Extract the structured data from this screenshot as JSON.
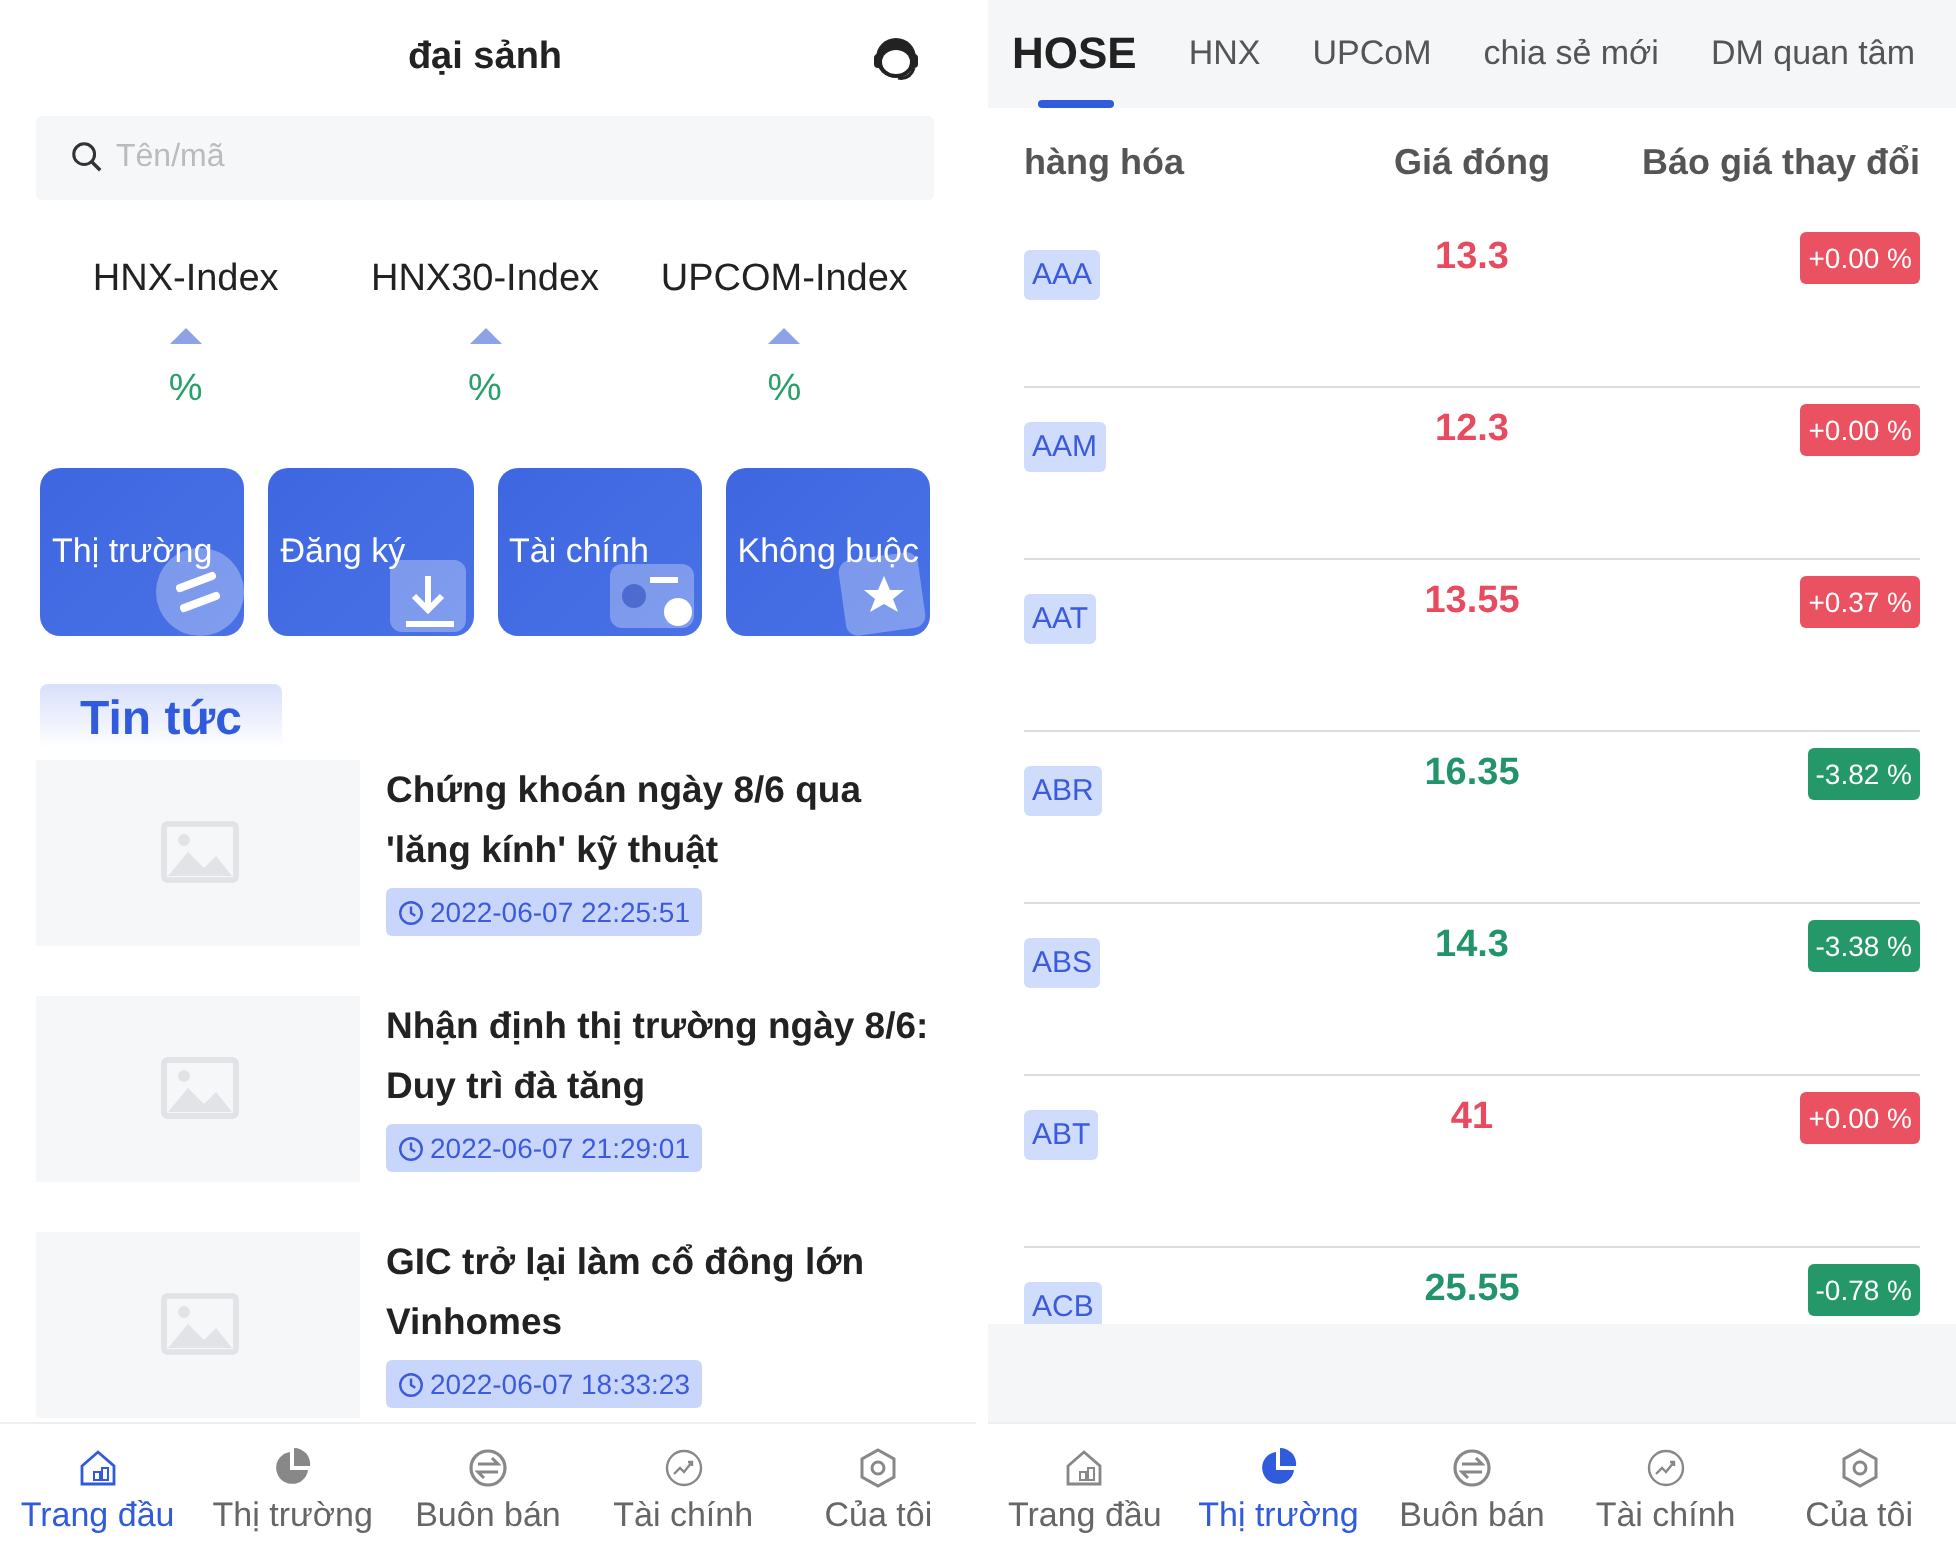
{
  "home": {
    "title": "đại sảnh",
    "search": {
      "placeholder": "Tên/mã"
    },
    "indices": [
      {
        "name": "HNX-Index",
        "percent": "%"
      },
      {
        "name": "HNX30-Index",
        "percent": "%"
      },
      {
        "name": "UPCOM-Index",
        "percent": "%"
      }
    ],
    "shortcuts": [
      {
        "label": "Thị trường",
        "kind": "exchange"
      },
      {
        "label": "Đăng ký",
        "kind": "download"
      },
      {
        "label": "Tài chính",
        "kind": "card"
      },
      {
        "label": "Không buộc",
        "kind": "star"
      }
    ],
    "news_title": "Tin tức",
    "news": [
      {
        "title": "Chứng khoán ngày 8/6 qua 'lăng kính' kỹ thuật",
        "time": "2022-06-07 22:25:51"
      },
      {
        "title": "Nhận định thị trường ngày 8/6: Duy trì đà tăng",
        "time": "2022-06-07 21:29:01"
      },
      {
        "title": "GIC trở lại làm cổ đông lớn Vinhomes",
        "time": "2022-06-07 18:33:23"
      }
    ],
    "nav": [
      {
        "label": "Trang đầu",
        "kind": "home",
        "selected": true
      },
      {
        "label": "Thị trường",
        "kind": "pie",
        "selected": false
      },
      {
        "label": "Buôn bán",
        "kind": "swap",
        "selected": false
      },
      {
        "label": "Tài chính",
        "kind": "trend",
        "selected": false
      },
      {
        "label": "Của tôi",
        "kind": "hex",
        "selected": false
      }
    ]
  },
  "market": {
    "tabs": [
      {
        "label": "HOSE",
        "selected": true
      },
      {
        "label": "HNX",
        "selected": false
      },
      {
        "label": "UPCoM",
        "selected": false
      },
      {
        "label": "chia sẻ mới",
        "selected": false
      },
      {
        "label": "DM quan tâm",
        "selected": false
      }
    ],
    "columns": [
      "hàng hóa",
      "Giá đóng",
      "Báo giá thay đổi"
    ],
    "rows": [
      {
        "symbol": "AAA",
        "price": "13.3",
        "change": "+0.00 %",
        "rising": true
      },
      {
        "symbol": "AAM",
        "price": "12.3",
        "change": "+0.00 %",
        "rising": true
      },
      {
        "symbol": "AAT",
        "price": "13.55",
        "change": "+0.37 %",
        "rising": true
      },
      {
        "symbol": "ABR",
        "price": "16.35",
        "change": "-3.82 %",
        "rising": false
      },
      {
        "symbol": "ABS",
        "price": "14.3",
        "change": "-3.38 %",
        "rising": false
      },
      {
        "symbol": "ABT",
        "price": "41",
        "change": "+0.00 %",
        "rising": true
      },
      {
        "symbol": "ACB",
        "price": "25.55",
        "change": "-0.78 %",
        "rising": false
      }
    ],
    "nav": [
      {
        "label": "Trang đầu",
        "kind": "home",
        "selected": false
      },
      {
        "label": "Thị trường",
        "kind": "pie",
        "selected": true
      },
      {
        "label": "Buôn bán",
        "kind": "swap",
        "selected": false
      },
      {
        "label": "Tài chính",
        "kind": "trend",
        "selected": false
      },
      {
        "label": "Của tôi",
        "kind": "hex",
        "selected": false
      }
    ]
  }
}
